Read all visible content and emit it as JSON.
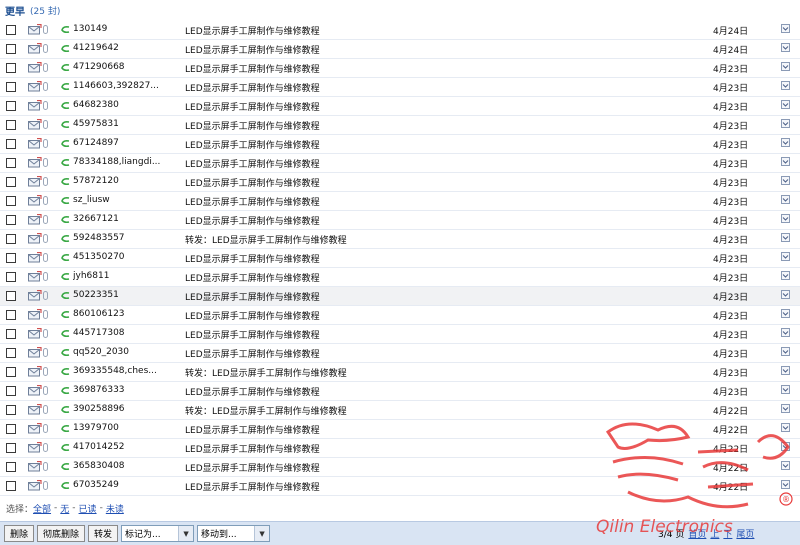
{
  "header": {
    "title": "更早",
    "count": "(25 封)"
  },
  "rows": [
    {
      "from": "130149",
      "subject": "LED显示屏手工屏制作与维修教程",
      "date": "4月24日"
    },
    {
      "from": "41219642",
      "subject": "LED显示屏手工屏制作与维修教程",
      "date": "4月24日"
    },
    {
      "from": "471290668",
      "subject": "LED显示屏手工屏制作与维修教程",
      "date": "4月23日"
    },
    {
      "from": "1146603,392827...",
      "subject": "LED显示屏手工屏制作与维修教程",
      "date": "4月23日"
    },
    {
      "from": "64682380",
      "subject": "LED显示屏手工屏制作与维修教程",
      "date": "4月23日"
    },
    {
      "from": "45975831",
      "subject": "LED显示屏手工屏制作与维修教程",
      "date": "4月23日"
    },
    {
      "from": "67124897",
      "subject": "LED显示屏手工屏制作与维修教程",
      "date": "4月23日"
    },
    {
      "from": "78334188,liangdi...",
      "subject": "LED显示屏手工屏制作与维修教程",
      "date": "4月23日"
    },
    {
      "from": "57872120",
      "subject": "LED显示屏手工屏制作与维修教程",
      "date": "4月23日"
    },
    {
      "from": "sz_liusw",
      "subject": "LED显示屏手工屏制作与维修教程",
      "date": "4月23日"
    },
    {
      "from": "32667121",
      "subject": "LED显示屏手工屏制作与维修教程",
      "date": "4月23日"
    },
    {
      "from": "592483557",
      "subject": "转发：LED显示屏手工屏制作与维修教程",
      "date": "4月23日"
    },
    {
      "from": "451350270",
      "subject": "LED显示屏手工屏制作与维修教程",
      "date": "4月23日"
    },
    {
      "from": "jyh6811",
      "subject": "LED显示屏手工屏制作与维修教程",
      "date": "4月23日"
    },
    {
      "from": "50223351",
      "subject": "LED显示屏手工屏制作与维修教程",
      "date": "4月23日",
      "highlight": true
    },
    {
      "from": "860106123",
      "subject": "LED显示屏手工屏制作与维修教程",
      "date": "4月23日"
    },
    {
      "from": "445717308",
      "subject": "LED显示屏手工屏制作与维修教程",
      "date": "4月23日"
    },
    {
      "from": "qq520_2030",
      "subject": "LED显示屏手工屏制作与维修教程",
      "date": "4月23日"
    },
    {
      "from": "369335548,ches...",
      "subject": "转发：LED显示屏手工屏制作与维修教程",
      "date": "4月23日"
    },
    {
      "from": "369876333",
      "subject": "LED显示屏手工屏制作与维修教程",
      "date": "4月23日"
    },
    {
      "from": "390258896",
      "subject": "转发：LED显示屏手工屏制作与维修教程",
      "date": "4月22日"
    },
    {
      "from": "13979700",
      "subject": "LED显示屏手工屏制作与维修教程",
      "date": "4月22日"
    },
    {
      "from": "417014252",
      "subject": "LED显示屏手工屏制作与维修教程",
      "date": "4月22日"
    },
    {
      "from": "365830408",
      "subject": "LED显示屏手工屏制作与维修教程",
      "date": "4月22日"
    },
    {
      "from": "67035249",
      "subject": "LED显示屏手工屏制作与维修教程",
      "date": "4月22日"
    }
  ],
  "select_bar": {
    "label": "选择：",
    "all": "全部",
    "none": "无",
    "read": "已读",
    "unread": "未读"
  },
  "toolbar": {
    "delete": "删除",
    "delete_permanent": "彻底删除",
    "forward": "转发",
    "mark_as": "标记为...",
    "move_to": "移动到...",
    "page_info": "3/4 页",
    "first": "首页",
    "prev": "上",
    "next": "下",
    "last": "尾页"
  },
  "watermark": {
    "brand": "Qilin Electronics",
    "registered": "®"
  },
  "colors": {
    "title": "#1d4f91",
    "link": "#1f4fb3",
    "toolbar_bg": "#d9e4f3",
    "watermark": "#e83a3a"
  }
}
